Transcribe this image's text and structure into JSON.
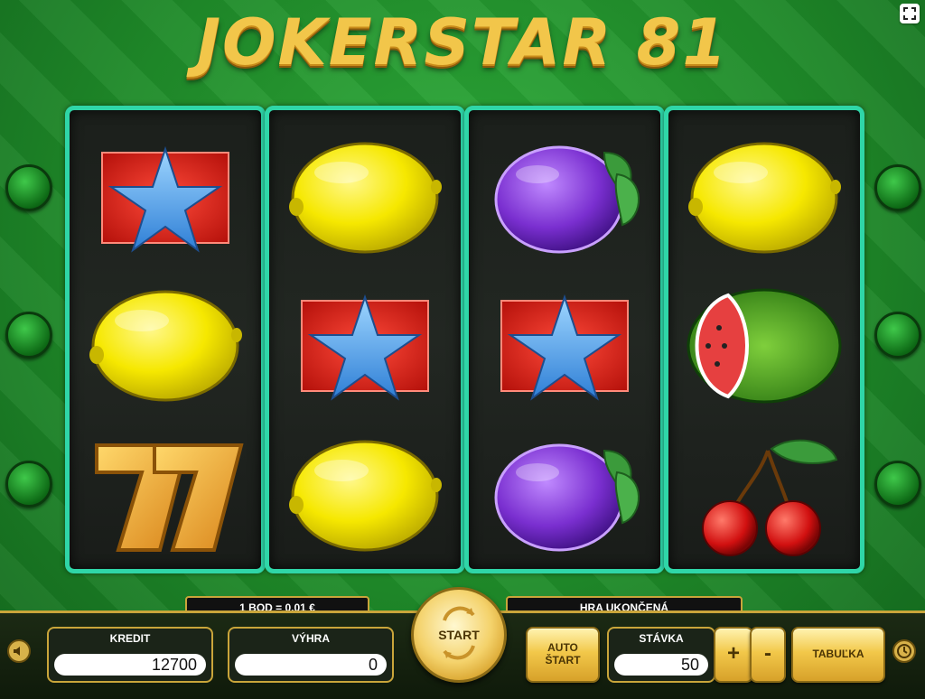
{
  "game": {
    "title": "JOKERSTAR 81"
  },
  "reels": [
    [
      "star",
      "lemon",
      "seven"
    ],
    [
      "lemon",
      "star",
      "lemon"
    ],
    [
      "plum",
      "star",
      "plum"
    ],
    [
      "lemon",
      "watermelon",
      "cherries"
    ]
  ],
  "info": {
    "rate": "1 BOD = 0,01 €",
    "status": "HRA UKONČENÁ"
  },
  "controls": {
    "credit_label": "KREDIT",
    "credit_value": "12700",
    "win_label": "VÝHRA",
    "win_value": "0",
    "start_label": "START",
    "auto_start_line1": "AUTO",
    "auto_start_line2": "ŠTART",
    "bet_label": "STÁVKA",
    "bet_value": "50",
    "plus_label": "+",
    "minus_label": "-",
    "paytable_label": "TABUĽKA"
  },
  "icons": {
    "fullscreen": "fullscreen-icon",
    "sound": "speaker-icon",
    "clock": "clock-icon",
    "spin": "refresh-arrows-icon"
  },
  "colors": {
    "reel_border": "#2fd6a8",
    "gold": "#f2c84a",
    "felt_green": "#1f8b2a"
  }
}
